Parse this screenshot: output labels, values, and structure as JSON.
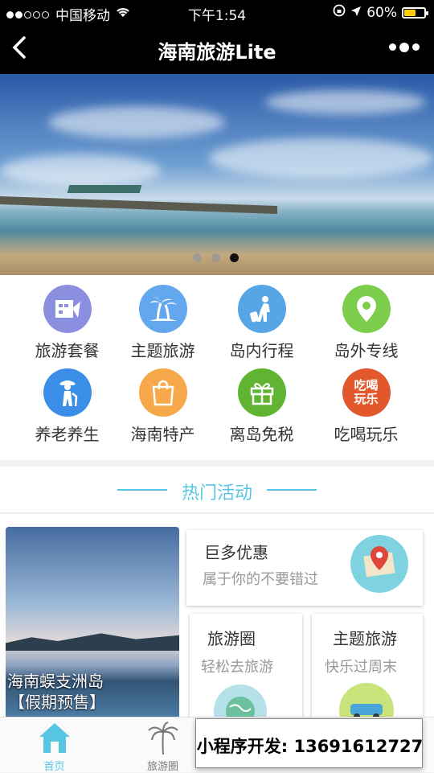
{
  "status_bar": {
    "carrier": "中国移动",
    "time": "下午1:54",
    "battery": "60%"
  },
  "nav": {
    "title": "海南旅游Lite"
  },
  "banner": {
    "slides": 3,
    "active_slide": 3
  },
  "categories": [
    {
      "label": "旅游套餐",
      "icon": "package-icon",
      "color": "#8b8fe0"
    },
    {
      "label": "主题旅游",
      "icon": "palm-tree-icon",
      "color": "#63a7ee"
    },
    {
      "label": "岛内行程",
      "icon": "traveler-icon",
      "color": "#58a5e6"
    },
    {
      "label": "岛外专线",
      "icon": "location-pin-icon",
      "color": "#7ccd4b"
    },
    {
      "label": "养老养生",
      "icon": "elderly-icon",
      "color": "#3b8ee8"
    },
    {
      "label": "海南特产",
      "icon": "shopping-bag-icon",
      "color": "#f7a84a"
    },
    {
      "label": "离岛免税",
      "icon": "gift-icon",
      "color": "#61b431"
    },
    {
      "label": "吃喝玩乐",
      "icon": "food-fun-icon",
      "color": "#e2572b",
      "glyph": "吃喝玩乐"
    }
  ],
  "section": {
    "title": "热门活动"
  },
  "featured": {
    "line1": "海南蜈支洲岛",
    "line2": "【假期预售】"
  },
  "cards": {
    "discount": {
      "title": "巨多优惠",
      "subtitle": "属于你的不要错过"
    },
    "circle": {
      "title": "旅游圈",
      "subtitle": "轻松去旅游"
    },
    "theme": {
      "title": "主题旅游",
      "subtitle": "快乐过周末"
    }
  },
  "tabs": [
    {
      "label": "首页",
      "icon": "home-icon",
      "active": true
    },
    {
      "label": "旅游圈",
      "icon": "palm-tree-icon",
      "active": false
    },
    {
      "label": "",
      "icon": "",
      "active": false
    },
    {
      "label": "",
      "icon": "",
      "active": false
    }
  ],
  "promo": {
    "text": "小程序开发: 13691612727"
  },
  "colors": {
    "accent": "#58c6e3"
  }
}
